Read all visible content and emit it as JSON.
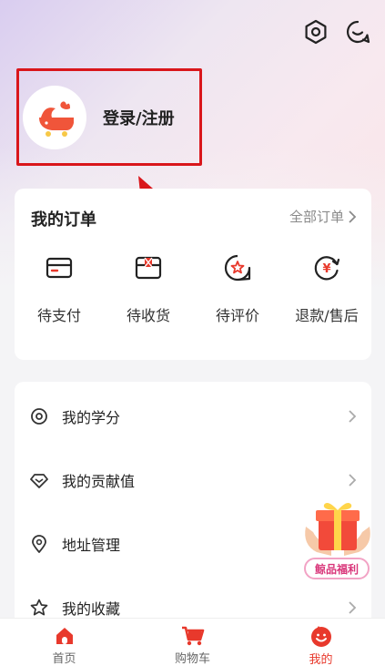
{
  "header": {
    "settings_icon": "settings-hexagon-icon",
    "service_icon": "customer-service-icon"
  },
  "profile": {
    "login_label": "登录/注册",
    "avatar_icon": "whale-logo-icon"
  },
  "orders": {
    "title": "我的订单",
    "all_label": "全部订单",
    "items": [
      {
        "label": "待支付",
        "icon": "card-payment-icon"
      },
      {
        "label": "待收货",
        "icon": "package-box-icon"
      },
      {
        "label": "待评价",
        "icon": "review-star-icon"
      },
      {
        "label": "退款/售后",
        "icon": "refund-yen-icon"
      }
    ]
  },
  "menu": {
    "items": [
      {
        "label": "我的学分",
        "icon": "credit-points-icon"
      },
      {
        "label": "我的贡献值",
        "icon": "diamond-contribution-icon"
      },
      {
        "label": "地址管理",
        "icon": "location-pin-icon"
      },
      {
        "label": "我的收藏",
        "icon": "star-favorite-icon"
      }
    ]
  },
  "promo": {
    "label": "鲸品福利",
    "icon": "gift-box-icon"
  },
  "tabbar": {
    "items": [
      {
        "label": "首页",
        "icon": "home-icon"
      },
      {
        "label": "购物车",
        "icon": "shopping-cart-icon"
      },
      {
        "label": "我的",
        "icon": "smiley-profile-icon"
      }
    ],
    "active_index": 2
  },
  "colors": {
    "accent": "#e8392c",
    "highlight_box": "#d9161b",
    "muted_text": "#8a8a8a"
  }
}
